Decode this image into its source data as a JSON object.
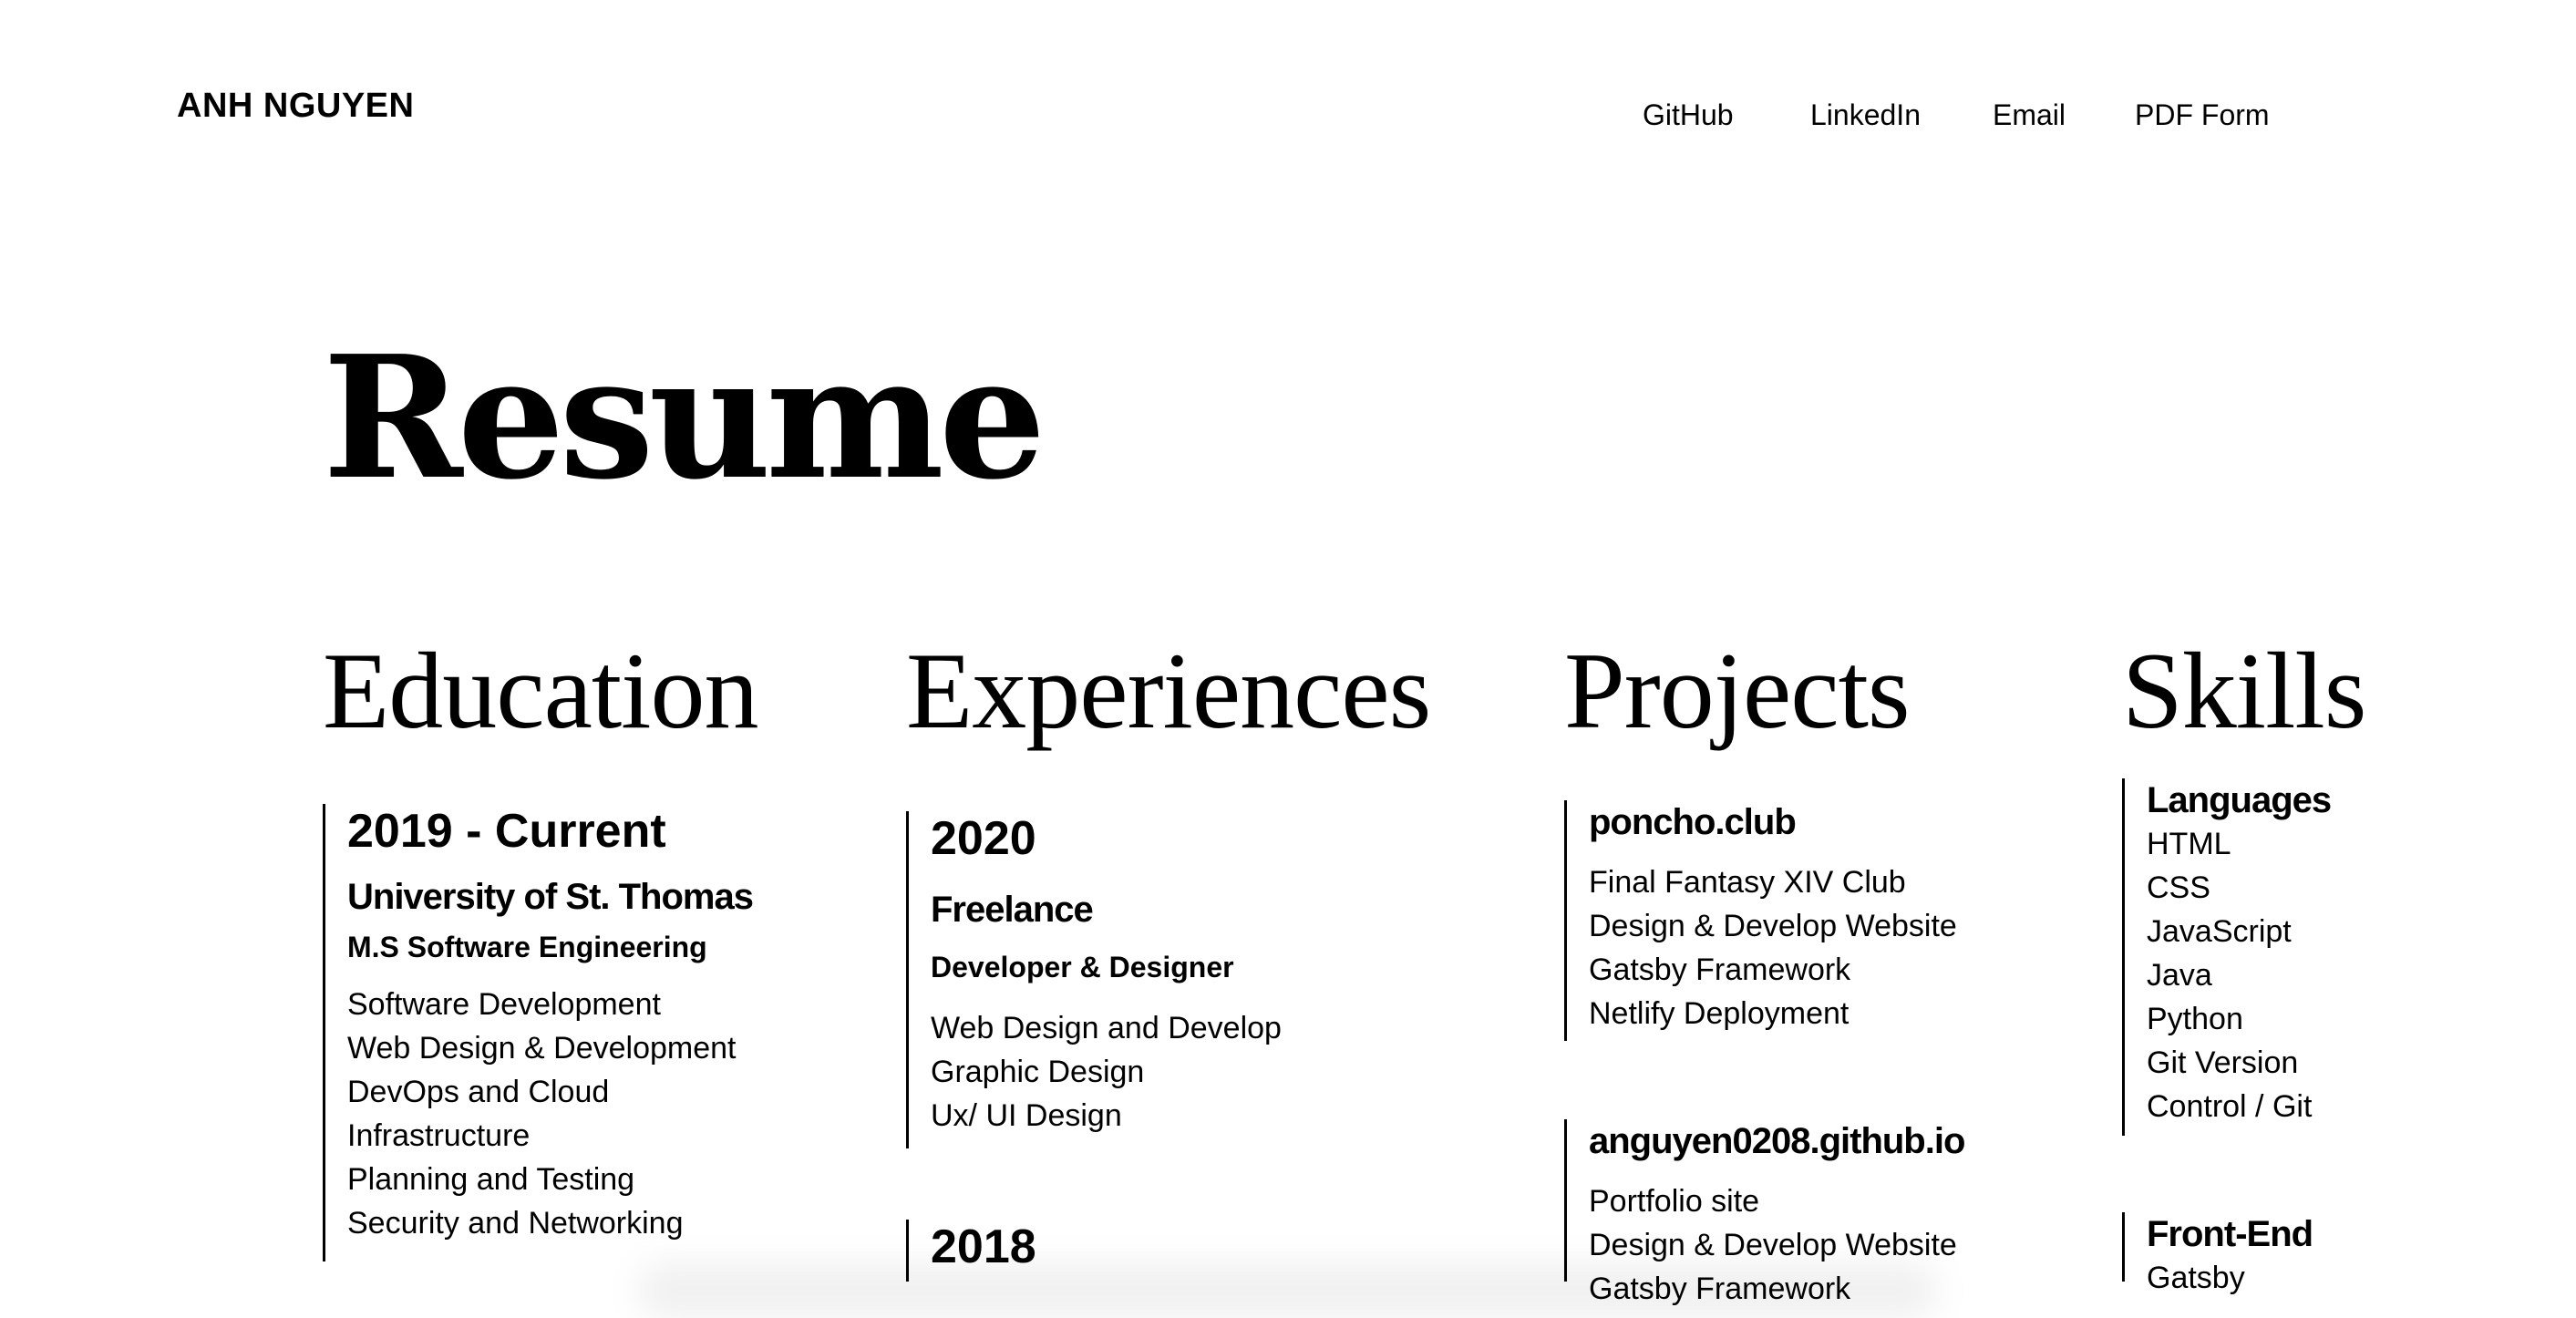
{
  "header": {
    "brand": "ANH NGUYEN",
    "nav": [
      "GitHub",
      "LinkedIn",
      "Email",
      "PDF Form"
    ]
  },
  "page": {
    "title": "Resume"
  },
  "education": {
    "title": "Education",
    "entries": [
      {
        "year": "2019 - Current",
        "school": "University of St. Thomas",
        "degree": "M.S Software Engineering",
        "courses": [
          "Software Development",
          "Web Design & Development",
          "DevOps and Cloud",
          "Infrastructure",
          "Planning and Testing",
          "Security and Networking"
        ]
      }
    ]
  },
  "experiences": {
    "title": "Experiences",
    "entries": [
      {
        "year": "2020",
        "company": "Freelance",
        "role": "Developer & Designer",
        "items": [
          "Web Design and Develop",
          "Graphic Design",
          "Ux/ UI Design"
        ]
      },
      {
        "year": "2018"
      }
    ]
  },
  "projects": {
    "title": "Projects",
    "entries": [
      {
        "name": "poncho.club",
        "items": [
          "Final Fantasy XIV Club",
          "Design & Develop Website",
          "Gatsby Framework",
          "Netlify Deployment"
        ]
      },
      {
        "name": "anguyen0208.github.io",
        "items": [
          "Portfolio site",
          "Design & Develop Website",
          "Gatsby Framework"
        ]
      }
    ]
  },
  "skills": {
    "title": "Skills",
    "groups": [
      {
        "name": "Languages",
        "items": [
          "HTML",
          "CSS",
          "JavaScript",
          "Java",
          "Python",
          "Git Version",
          "Control / Git"
        ]
      },
      {
        "name": "Front-End",
        "items": [
          "Gatsby"
        ]
      }
    ]
  }
}
